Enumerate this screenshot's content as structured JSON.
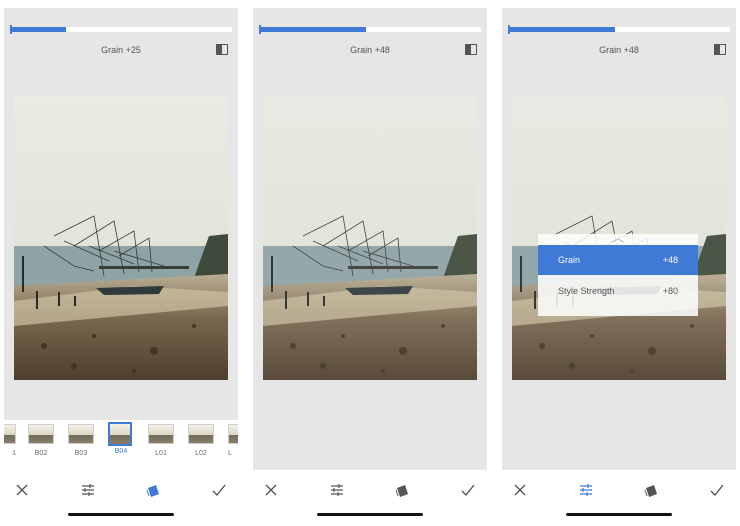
{
  "panels": [
    {
      "header": "Grain +25",
      "slider_value": 0.25,
      "filters": [
        {
          "label": "1",
          "selected": false
        },
        {
          "label": "B02",
          "selected": false
        },
        {
          "label": "B03",
          "selected": false
        },
        {
          "label": "B04",
          "selected": true
        },
        {
          "label": "L01",
          "selected": false
        },
        {
          "label": "L02",
          "selected": false
        },
        {
          "label": "L",
          "selected": false
        }
      ],
      "active_tool": "styles"
    },
    {
      "header": "Grain +48",
      "slider_value": 0.48,
      "active_tool": "none"
    },
    {
      "header": "Grain +48",
      "slider_value": 0.48,
      "active_tool": "tune",
      "menu": [
        {
          "label": "Grain",
          "value": "+48",
          "active": true
        },
        {
          "label": "Style Strength",
          "value": "+80",
          "active": false
        }
      ]
    }
  ],
  "icons": {
    "close": "close-icon",
    "tune": "tune-icon",
    "styles": "styles-icon",
    "check": "check-icon",
    "compare": "compare-icon"
  },
  "colors": {
    "accent": "#3e7ad6",
    "panel_bg": "#e6e6e6",
    "icon": "#555555"
  }
}
